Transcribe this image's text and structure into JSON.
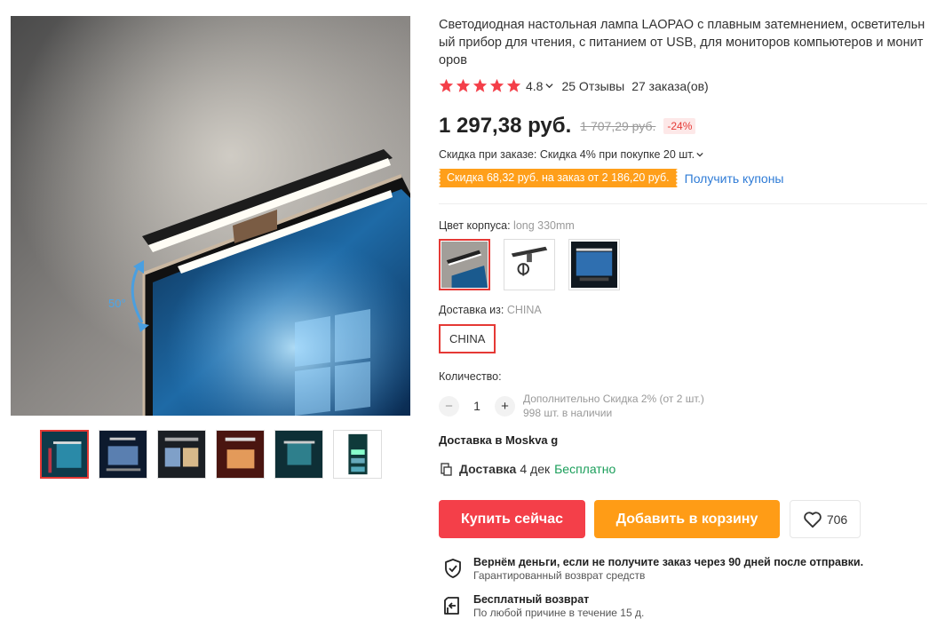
{
  "product": {
    "title": "Светодиодная настольная лампа LAOPAO с плавным затемнением, осветительный прибор для чтения, с питанием от USB, для мониторов компьютеров и мониторов",
    "image_label": "50°"
  },
  "rating": {
    "value": "4.8",
    "stars": 5,
    "reviews": "25 Отзывы",
    "orders": "27 заказа(ов)"
  },
  "price": {
    "current": "1 297,38 руб.",
    "old": "1 707,29 руб.",
    "discount": "-24%"
  },
  "promo": {
    "bulk_label": "Скидка при заказе:",
    "bulk_value": "Скидка 4% при покупке 20 шт.",
    "coupon_badge": "Скидка 68,32 руб. на заказ от 2 186,20 руб.",
    "coupon_link": "Получить купоны"
  },
  "color": {
    "label": "Цвет корпуса:",
    "selected": "long 330mm",
    "options_count": 3
  },
  "shipping": {
    "label": "Доставка из:",
    "selected": "CHINA",
    "option": "CHINA"
  },
  "quantity": {
    "label": "Количество:",
    "minus": "−",
    "plus": "+",
    "value": "1",
    "extra_discount": "Дополнительно Скидка 2% (от 2 шт.)",
    "stock": "998 шт. в наличии"
  },
  "delivery": {
    "to": "Доставка в Moskva g",
    "label": "Доставка",
    "days": "4 дек",
    "price": "Бесплатно"
  },
  "actions": {
    "buy": "Купить сейчас",
    "cart": "Добавить в корзину",
    "wishlist_count": "706"
  },
  "guarantees": [
    {
      "title": "Вернём деньги, если не получите заказ через 90 дней после отправки.",
      "subtitle": "Гарантированный возврат средств",
      "icon": "shield-check-icon"
    },
    {
      "title": "Бесплатный возврат",
      "subtitle": "По любой причине в течение 15 д.",
      "icon": "return-box-icon"
    }
  ],
  "colors": {
    "star": "#f43f49",
    "price_red": "#e53935",
    "buy": "#f43f49",
    "cart": "#ff9c16",
    "coupon": "#ff9f1a",
    "link": "#2e7bd6",
    "free": "#1a9e5a"
  },
  "gallery": {
    "thumbnail_count": 6,
    "active_index": 0
  }
}
